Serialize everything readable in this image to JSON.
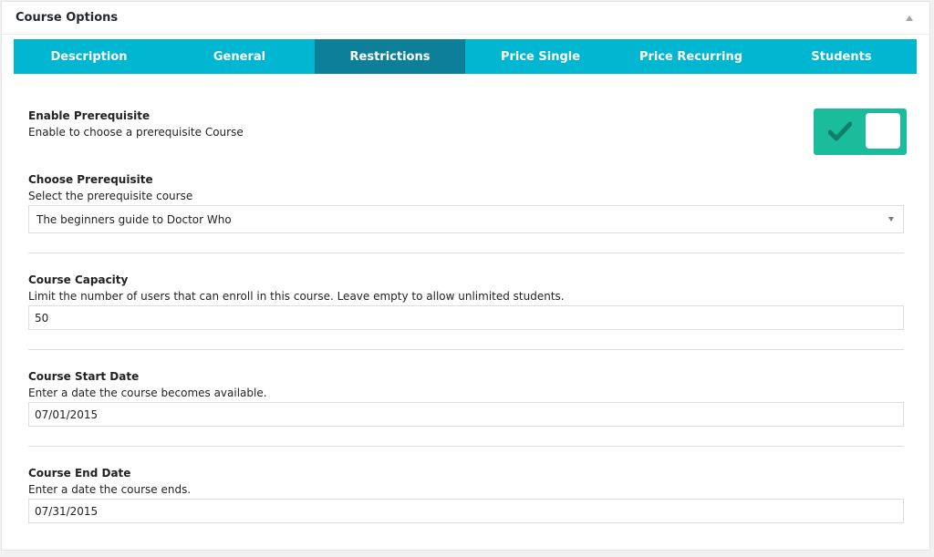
{
  "panel": {
    "title": "Course Options"
  },
  "tabs": [
    {
      "label": "Description",
      "active": false
    },
    {
      "label": "General",
      "active": false
    },
    {
      "label": "Restrictions",
      "active": true
    },
    {
      "label": "Price Single",
      "active": false
    },
    {
      "label": "Price Recurring",
      "active": false
    },
    {
      "label": "Students",
      "active": false
    }
  ],
  "fields": {
    "prerequisite_toggle": {
      "label": "Enable Prerequisite",
      "description": "Enable to choose a prerequisite Course",
      "enabled": true
    },
    "prerequisite_select": {
      "label": "Choose Prerequisite",
      "description": "Select the prerequisite course",
      "value": "The beginners guide to Doctor Who"
    },
    "capacity": {
      "label": "Course Capacity",
      "description": "Limit the number of users that can enroll in this course. Leave empty to allow unlimited students.",
      "value": "50"
    },
    "start_date": {
      "label": "Course Start Date",
      "description": "Enter a date the course becomes available.",
      "value": "07/01/2015"
    },
    "end_date": {
      "label": "Course End Date",
      "description": "Enter a date the course ends.",
      "value": "07/31/2015"
    }
  },
  "colors": {
    "tab_bar": "#00b6d0",
    "tab_active": "#0e7f99",
    "toggle_on": "#1bbc9b"
  },
  "icons": {
    "collapse": "triangle-up-icon",
    "toggle_check": "checkmark-icon",
    "select_arrow": "caret-down-icon"
  }
}
